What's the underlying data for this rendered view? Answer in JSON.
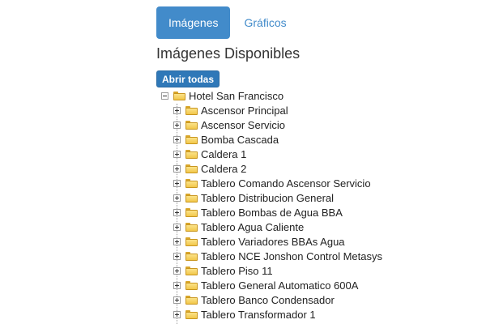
{
  "tabs": [
    {
      "label": "Imágenes",
      "active": true
    },
    {
      "label": "Gráficos",
      "active": false
    }
  ],
  "section_title": "Imágenes Disponibles",
  "open_all_button": "Abrir todas",
  "tree": {
    "root_label": "Hotel San Francisco",
    "children": [
      "Ascensor Principal",
      "Ascensor Servicio",
      "Bomba Cascada",
      "Caldera 1",
      "Caldera 2",
      "Tablero Comando Ascensor Servicio",
      "Tablero Distribucion General",
      "Tablero Bombas de Agua BBA",
      "Tablero Agua Caliente",
      "Tablero Variadores BBAs Agua",
      "Tablero NCE Jonshon Control Metasys",
      "Tablero Piso 11",
      "Tablero General Automatico 600A",
      "Tablero Banco Condensador",
      "Tablero Transformador 1"
    ]
  },
  "colors": {
    "accent": "#428bca",
    "button": "#2f78b8",
    "folder": "#f2c74a"
  }
}
